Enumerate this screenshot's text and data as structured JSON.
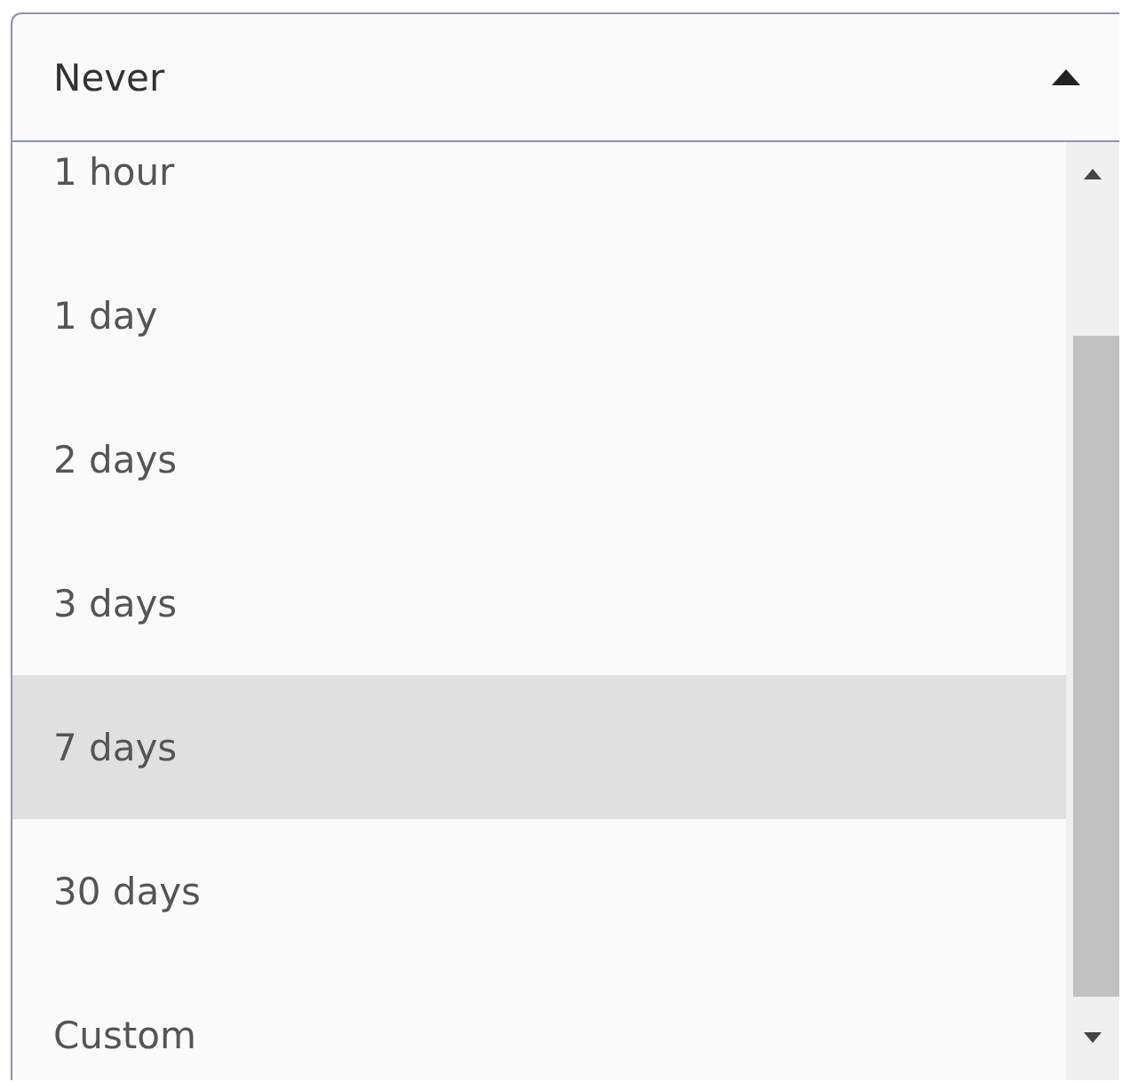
{
  "select": {
    "value": "Never",
    "expanded": true
  },
  "options": [
    {
      "label": "1 hour",
      "selected": false
    },
    {
      "label": "1 day",
      "selected": false
    },
    {
      "label": "2 days",
      "selected": false
    },
    {
      "label": "3 days",
      "selected": false
    },
    {
      "label": "7 days",
      "selected": true
    },
    {
      "label": "30 days",
      "selected": false
    },
    {
      "label": "Custom",
      "selected": false
    }
  ]
}
